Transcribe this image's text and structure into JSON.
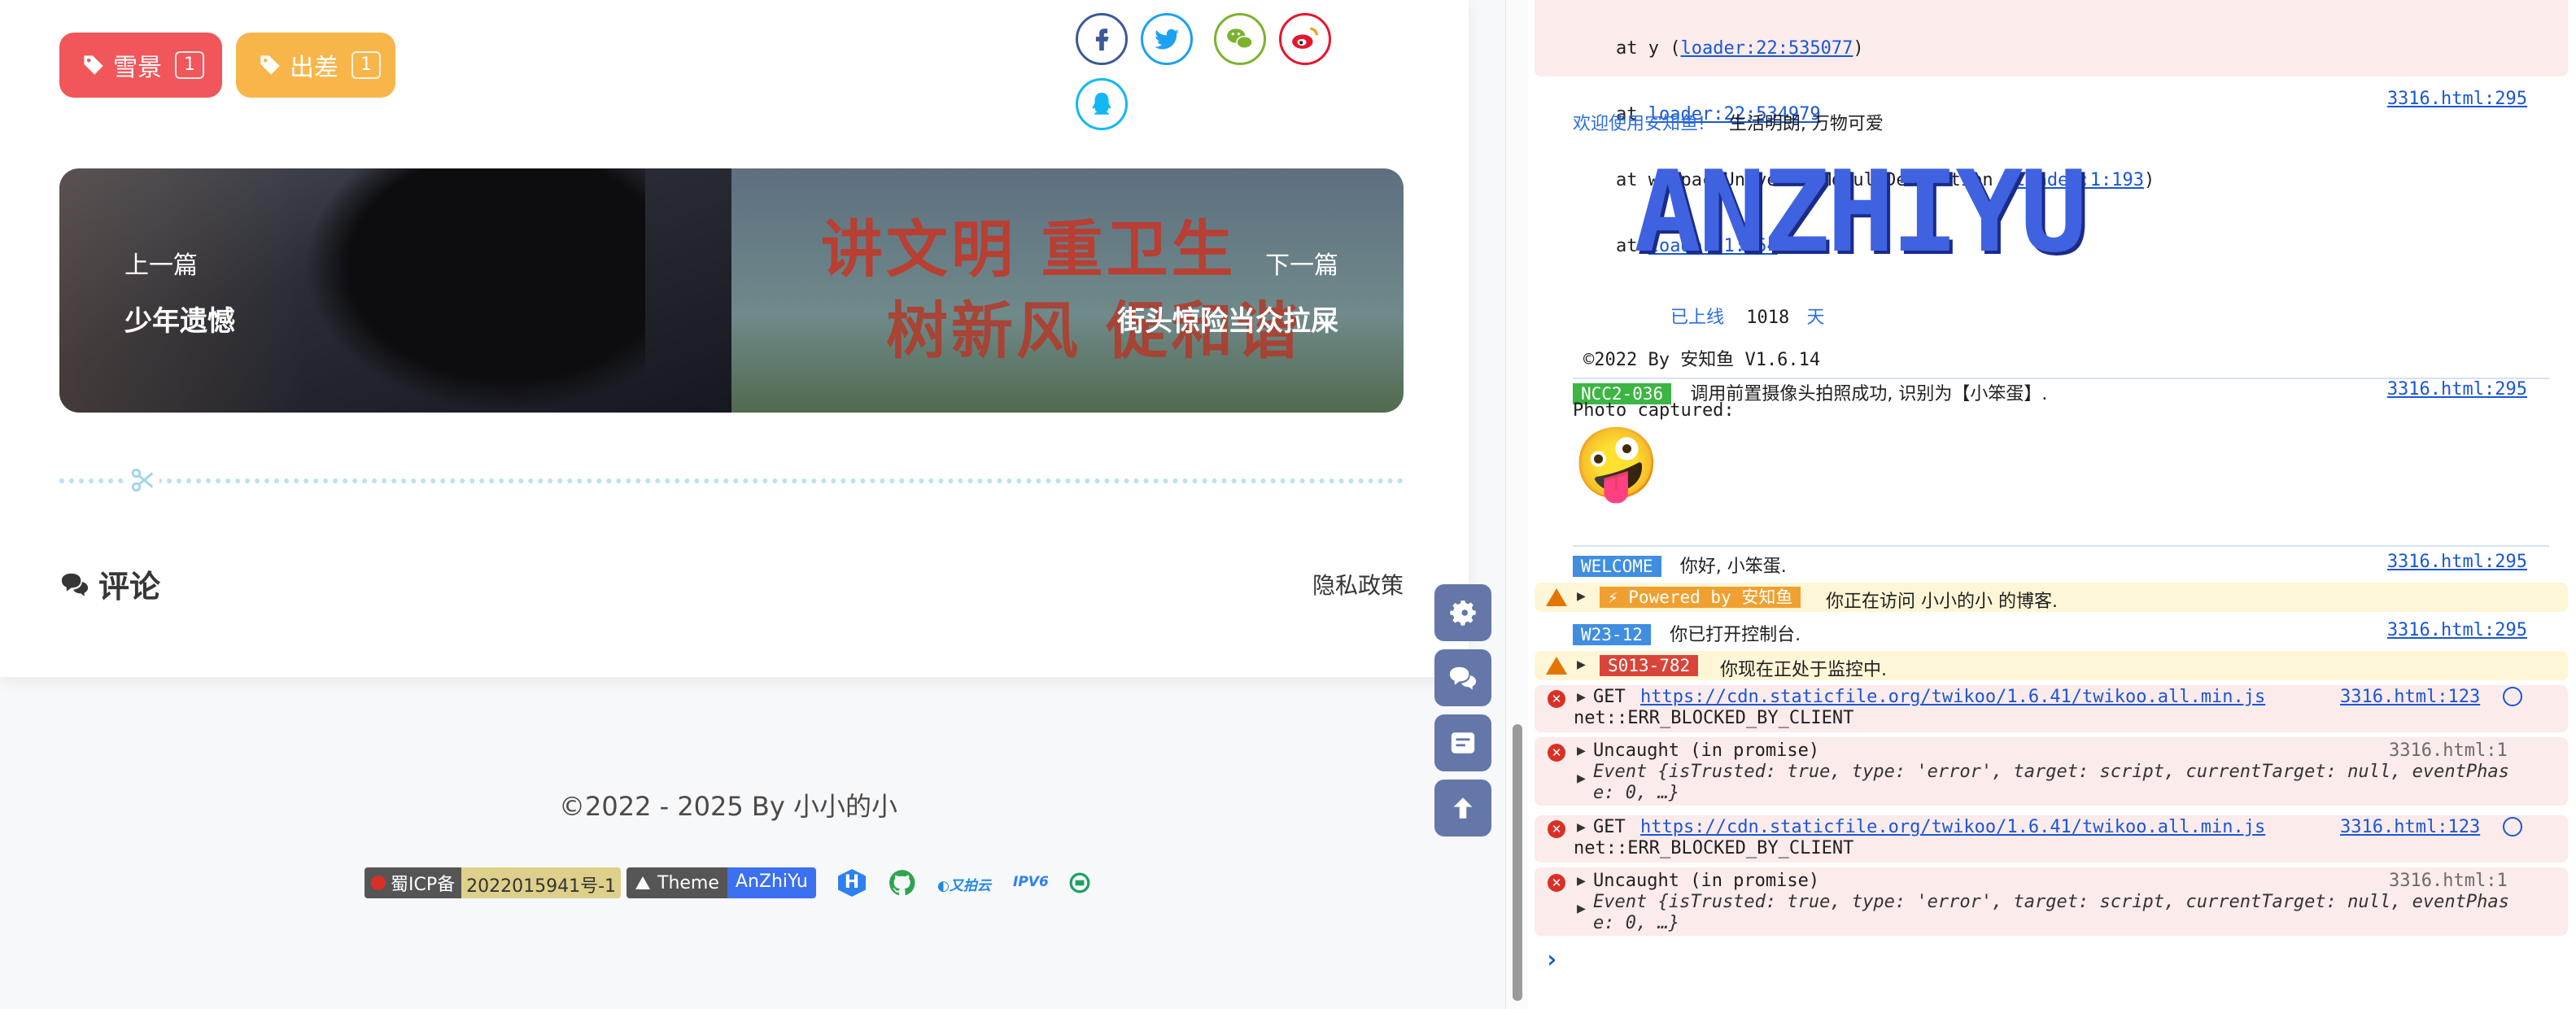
{
  "tags": [
    {
      "label": "雪景",
      "count": "1",
      "color": "#f0565a"
    },
    {
      "label": "出差",
      "count": "1",
      "color": "#f8b64a"
    }
  ],
  "share_icons": [
    "facebook-icon",
    "twitter-icon",
    "wechat-icon",
    "weibo-icon",
    "qq-icon"
  ],
  "nav": {
    "prev_label": "上一篇",
    "prev_title": "少年遗憾",
    "next_label": "下一篇",
    "next_title": "街头惊险当众拉屎",
    "next_image_text_line1": "讲文明 重卫生",
    "next_image_text_line2": "树新风 促和谐"
  },
  "comments": {
    "title": "评论",
    "privacy": "隐私政策"
  },
  "footer": {
    "copyright": "©2022 - 2025 By 小小的小",
    "icp_label": "蜀ICP备",
    "icp_value": "2022015941号-1",
    "theme_label": "Theme",
    "theme_value": "AnZhiYu"
  },
  "console": {
    "stack": [
      {
        "prefix": "at y (",
        "link": "loader:22:535077",
        "suffix": ")"
      },
      {
        "prefix": "at ",
        "link": "loader:22:534979",
        "suffix": ""
      },
      {
        "prefix": "at webpackUniversalModuleDefinition (",
        "link": "loader:1:193",
        "suffix": ")"
      },
      {
        "prefix": "at ",
        "link": "loader:1:254",
        "suffix": ""
      }
    ],
    "src_295": "3316.html:295",
    "welcome_blue": "欢迎使用安知鱼!",
    "welcome_text": "生活明朗, 万物可爱",
    "ascii_logo": "ANZHIYU",
    "online_label": "已上线",
    "online_days": "1018",
    "online_unit": "天",
    "copyright": "©2022 By 安知鱼 V1.6.14",
    "ncc_badge": "NCC2-036",
    "ncc_text": "调用前置摄像头拍照成功, 识别为【小笨蛋】.",
    "photo_text": "Photo captured:",
    "emoji": "🤪",
    "welcome_badge": "WELCOME",
    "welcome_msg": "你好, 小笨蛋.",
    "powered_badge": "⚡ Powered by 安知鱼",
    "powered_msg": "你正在访问 小小的小 的博客.",
    "w23_badge": "W23-12",
    "w23_msg": "你已打开控制台.",
    "s013_badge": "S013-782",
    "s013_msg": "你现在正处于监控中.",
    "get_prefix": "GET",
    "get_url": "https://cdn.staticfile.org/twikoo/1.6.41/twikoo.all.min.js",
    "get_src": "3316.html:123",
    "get_err": "net::ERR_BLOCKED_BY_CLIENT",
    "uncaught": "Uncaught (in promise)",
    "uncaught_src": "3316.html:1",
    "event_line1": "Event {isTrusted: true, type: 'error', target: script, currentTarget: null, eventPhas",
    "event_line2": "e: 0, …}",
    "prompt": "›"
  }
}
